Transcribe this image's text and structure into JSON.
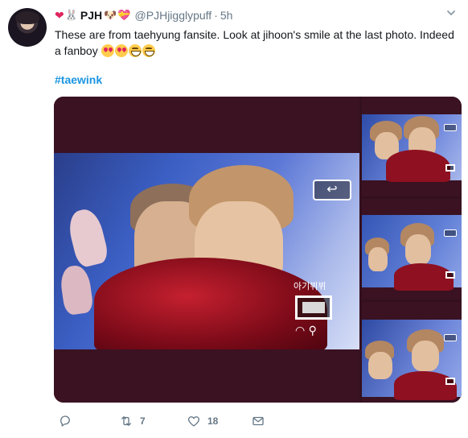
{
  "tweet": {
    "author": {
      "display_name": "PJH",
      "handle": "@PJHjigglypuff",
      "timestamp": "5h",
      "separator": "·",
      "name_emoji_prefix": [
        "heart",
        "rabbit-face"
      ],
      "name_emoji_suffix": [
        "dog-face",
        "heart-with-ribbon"
      ]
    },
    "body_text": "These are from taehyung fansite. Look at jihoon's smile at the last photo. Indeed a fanboy",
    "body_emojis": [
      "heart-eyes",
      "heart-eyes",
      "grinning",
      "grinning"
    ],
    "hashtag": "#taewink",
    "media": {
      "count": 4,
      "overlay": {
        "back_glyph": "↩",
        "korean_label": "아기뷔뷔",
        "tools_glyph": "◠ ⚲"
      }
    },
    "actions": {
      "reply_count": "",
      "retweet_count": "7",
      "like_count": "18"
    }
  },
  "colors": {
    "link": "#1b95e0",
    "muted": "#657786",
    "text": "#14171a",
    "like_heart": "#e0245e"
  }
}
